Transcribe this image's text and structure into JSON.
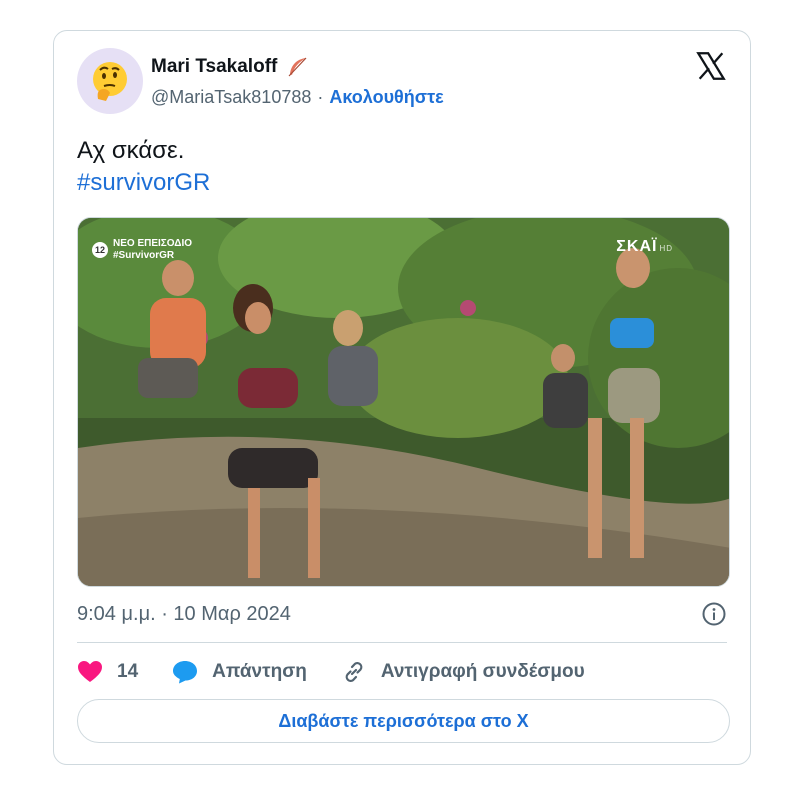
{
  "author": {
    "display_name": "Mari Tsakaloff",
    "handle": "@MariaTsak810788",
    "separator": "·",
    "follow_label": "Ακολουθήστε",
    "avatar_icon": "thinking-face-emoji",
    "name_emoji": "feather-emoji"
  },
  "tweet": {
    "text": "Αχ σκάσε.",
    "hashtag": "#survivorGR"
  },
  "media": {
    "episode_number": "12",
    "episode_label": "ΝΕΟ ΕΠΕΙΣΟΔΙΟ",
    "episode_tag": "#SurvivorGR",
    "channel_logo": "ΣΚΑΪ",
    "channel_suffix": "HD"
  },
  "timestamp": "9:04 μ.μ. · 10 Μαρ 2024",
  "actions": {
    "like_count": "14",
    "reply_label": "Απάντηση",
    "copy_link_label": "Αντιγραφή συνδέσμου"
  },
  "read_more_label": "Διαβάστε περισσότερα στο X",
  "colors": {
    "link": "#1d6fd6",
    "like": "#f91880",
    "reply": "#1d9bf0",
    "muted": "#536471",
    "border": "#cfd9de"
  }
}
